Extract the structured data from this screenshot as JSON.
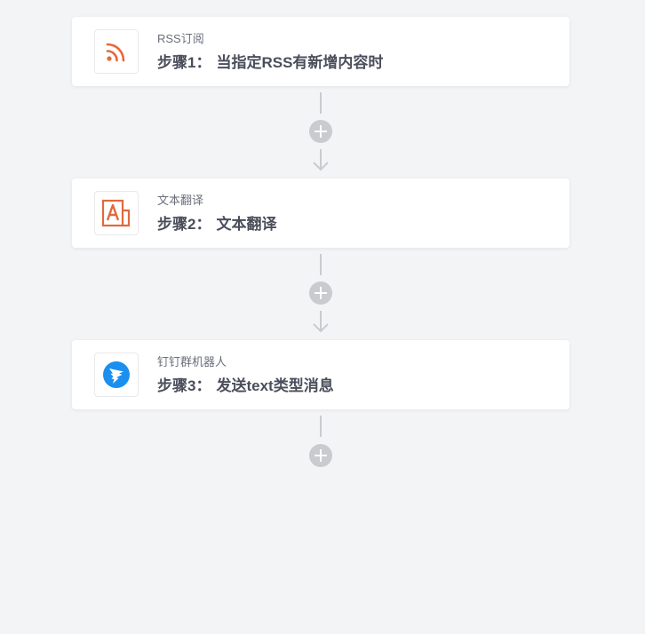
{
  "workflow": {
    "steps": [
      {
        "app_name": "RSS订阅",
        "step_label": "步骤1",
        "separator": "：",
        "step_desc": "当指定RSS有新增内容时",
        "icon": "rss-icon",
        "icon_color": "#e8683a"
      },
      {
        "app_name": "文本翻译",
        "step_label": "步骤2",
        "separator": "：",
        "step_desc": "文本翻译",
        "icon": "translate-icon",
        "icon_color": "#e06a3c"
      },
      {
        "app_name": "钉钉群机器人",
        "step_label": "步骤3",
        "separator": "：",
        "step_desc": "发送text类型消息",
        "icon": "dingtalk-icon",
        "icon_color": "#1a8ff0"
      }
    ],
    "connector_color": "#c9cbcf"
  }
}
